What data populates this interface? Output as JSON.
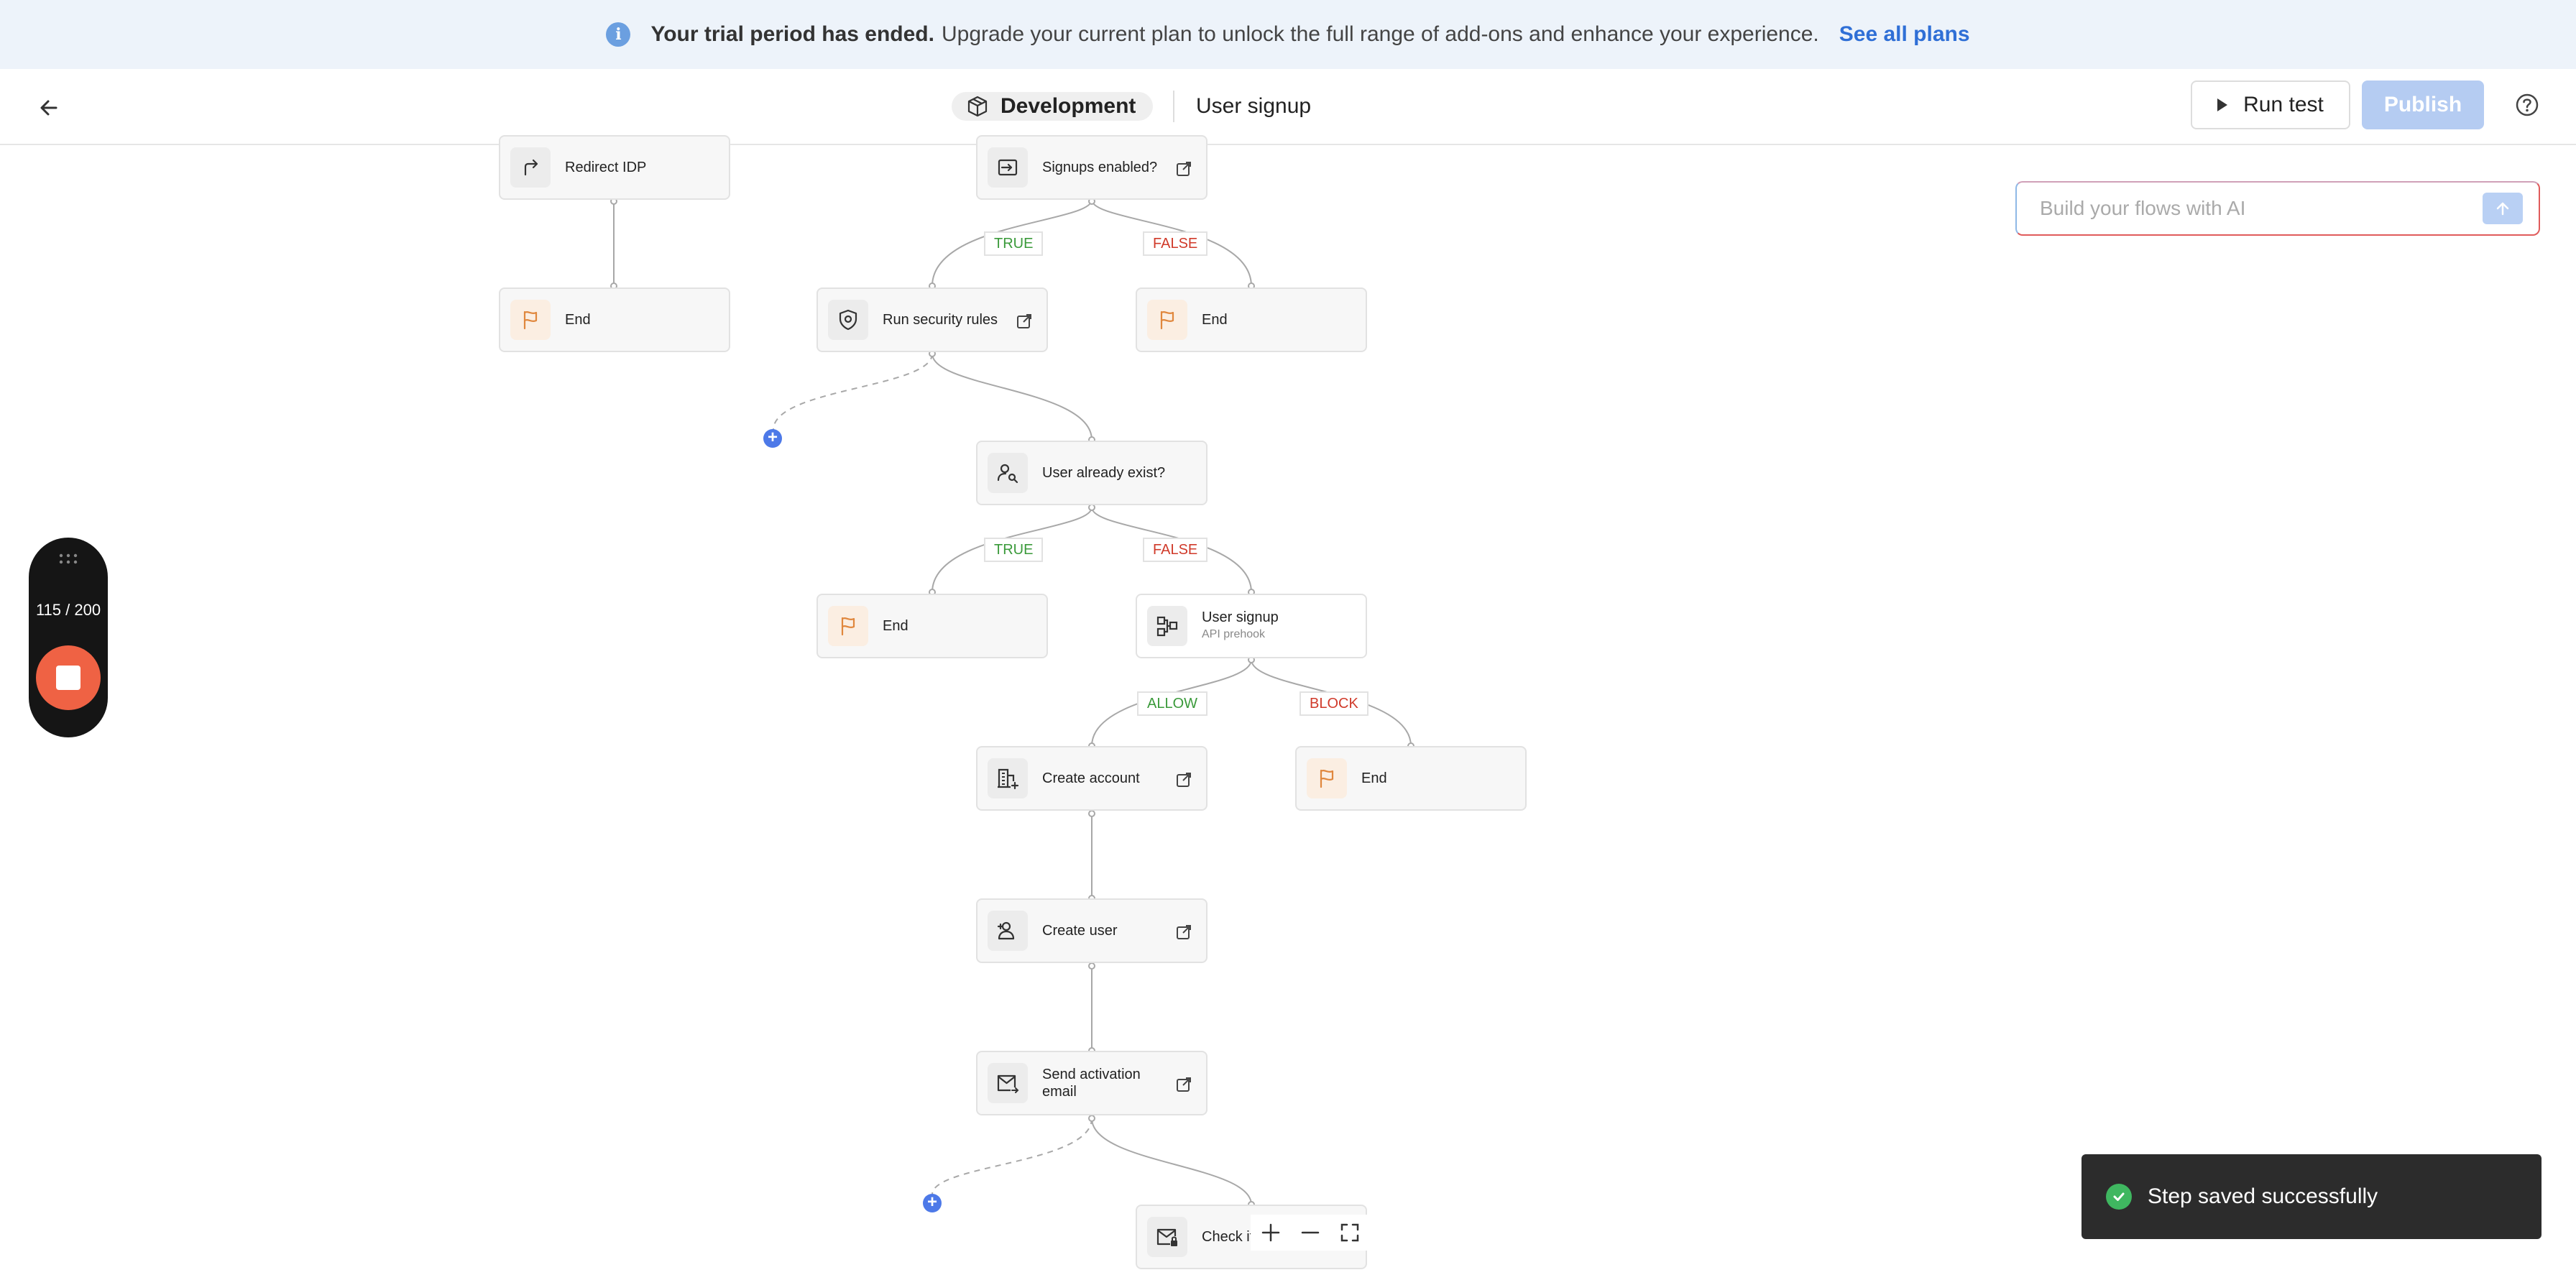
{
  "banner": {
    "bold_text": "Your trial period has ended.",
    "text": "Upgrade your current plan to unlock the full range of add-ons and enhance your experience.",
    "link": "See all plans"
  },
  "header": {
    "environment": "Development",
    "flow_name": "User signup",
    "run_test_label": "Run test",
    "publish_label": "Publish"
  },
  "ai_input": {
    "placeholder": "Build your flows with AI"
  },
  "nodes": {
    "redirect_idp": "Redirect IDP",
    "end_1": "End",
    "signups_enabled": "Signups enabled?",
    "run_security_rules": "Run security rules",
    "end_2": "End",
    "user_already_exist": "User already exist?",
    "end_3": "End",
    "user_signup": "User signup",
    "user_signup_sub": "API prehook",
    "create_account": "Create account",
    "end_4": "End",
    "create_user": "Create user",
    "send_activation_email": "Send activation email",
    "check_if": "Check if"
  },
  "branches": {
    "true_1": "TRUE",
    "false_1": "FALSE",
    "true_2": "TRUE",
    "false_2": "FALSE",
    "allow": "ALLOW",
    "block": "BLOCK"
  },
  "recorder": {
    "count": "115 / 200"
  },
  "toast": {
    "message": "Step saved successfully"
  }
}
